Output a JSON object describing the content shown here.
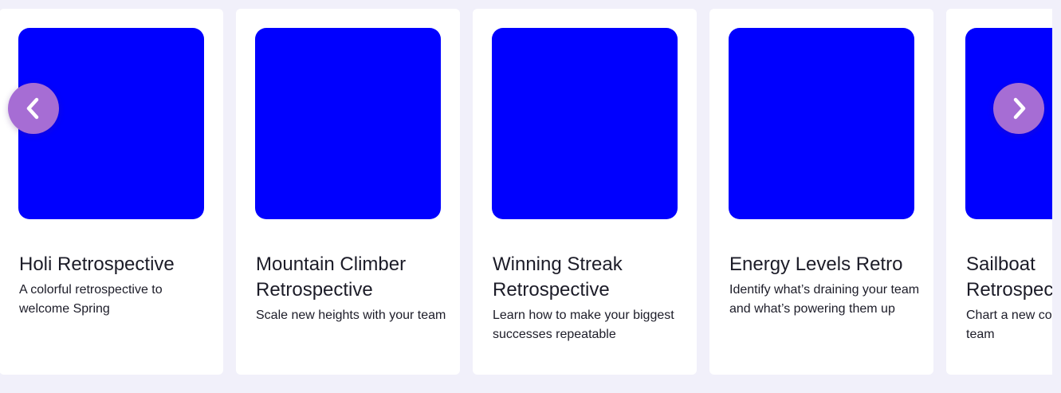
{
  "carousel": {
    "prev_icon": "chevron-left-icon",
    "next_icon": "chevron-right-icon",
    "button_color": "#a66dd4",
    "cards": [
      {
        "title": "Holi Retrospective",
        "description": "A colorful retrospective to welcome Spring",
        "thumbnail_color": "#0000ff"
      },
      {
        "title": "Mountain Climber Retrospective",
        "description": "Scale new heights with your team",
        "thumbnail_color": "#0000ff"
      },
      {
        "title": "Winning Streak Retrospective",
        "description": "Learn how to make your biggest successes repeatable",
        "thumbnail_color": "#0000ff"
      },
      {
        "title": "Energy Levels Retro",
        "description": "Identify what’s draining your team and what’s powering them up",
        "thumbnail_color": "#0000ff"
      },
      {
        "title": "Sailboat Retrospective",
        "description": "Chart a new course with your team",
        "thumbnail_color": "#0000ff"
      }
    ]
  }
}
